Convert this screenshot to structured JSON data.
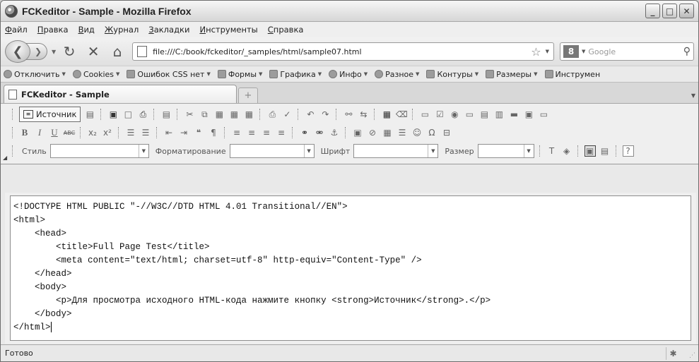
{
  "window": {
    "title": "FCKeditor - Sample - Mozilla Firefox"
  },
  "menu": [
    "Файл",
    "Правка",
    "Вид",
    "Журнал",
    "Закладки",
    "Инструменты",
    "Справка"
  ],
  "nav": {
    "url": "file:///C:/book/fckeditor/_samples/html/sample07.html",
    "search_placeholder": "Google"
  },
  "devbar": {
    "items": [
      "Отключить",
      "Cookies",
      "Ошибок CSS нет",
      "Формы",
      "Графика",
      "Инфо",
      "Разное",
      "Контуры",
      "Размеры",
      "Инструмен"
    ]
  },
  "tab": {
    "title": "FCKeditor - Sample",
    "new_tab": "+"
  },
  "fck": {
    "source_label": "Источник",
    "style_label": "Стиль",
    "format_label": "Форматирование",
    "font_label": "Шрифт",
    "size_label": "Размер"
  },
  "editor": {
    "lines": [
      "<!DOCTYPE HTML PUBLIC \"-//W3C//DTD HTML 4.01 Transitional//EN\">",
      "<html>",
      "    <head>",
      "        <title>Full Page Test</title>",
      "        <meta content=\"text/html; charset=utf-8\" http-equiv=\"Content-Type\" />",
      "    </head>",
      "    <body>",
      "        <p>Для просмотра исходного HTML-кода нажмите кнопку <strong>Источник</strong>.</p>",
      "    </body>",
      "</html>"
    ]
  },
  "status": {
    "text": "Готово"
  }
}
